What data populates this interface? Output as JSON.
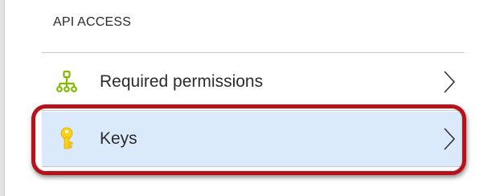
{
  "section": {
    "title": "API ACCESS"
  },
  "items": [
    {
      "label": "Required permissions",
      "icon": "hierarchy-network-icon",
      "icon_color": "#7fba00",
      "selected": false
    },
    {
      "label": "Keys",
      "icon": "key-icon",
      "icon_color": "#fcd116",
      "selected": true
    }
  ],
  "colors": {
    "selected_background": "#dbeafb",
    "highlight_ring": "#b5121b"
  }
}
